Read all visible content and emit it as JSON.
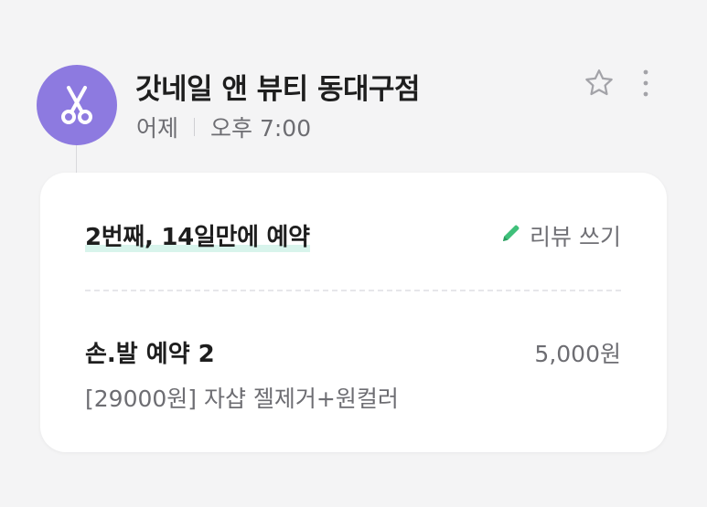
{
  "header": {
    "store_name": "갓네일 앤 뷰티 동대구점",
    "date": "어제",
    "time": "오후 7:00",
    "avatar_icon": "scissors-icon",
    "avatar_color": "#8d7ae0"
  },
  "actions": {
    "favorite_icon": "star-outline-icon",
    "more_icon": "more-vertical-icon"
  },
  "card": {
    "visit_info": "2번째, 14일만에 예약",
    "review_label": "리뷰 쓰기",
    "review_icon": "pencil-icon",
    "review_icon_color": "#3fc07a",
    "item_name": "손.발 예약 2",
    "item_price": "5,000원",
    "item_option": "[29000원] 자샵 젤제거+원컬러"
  }
}
